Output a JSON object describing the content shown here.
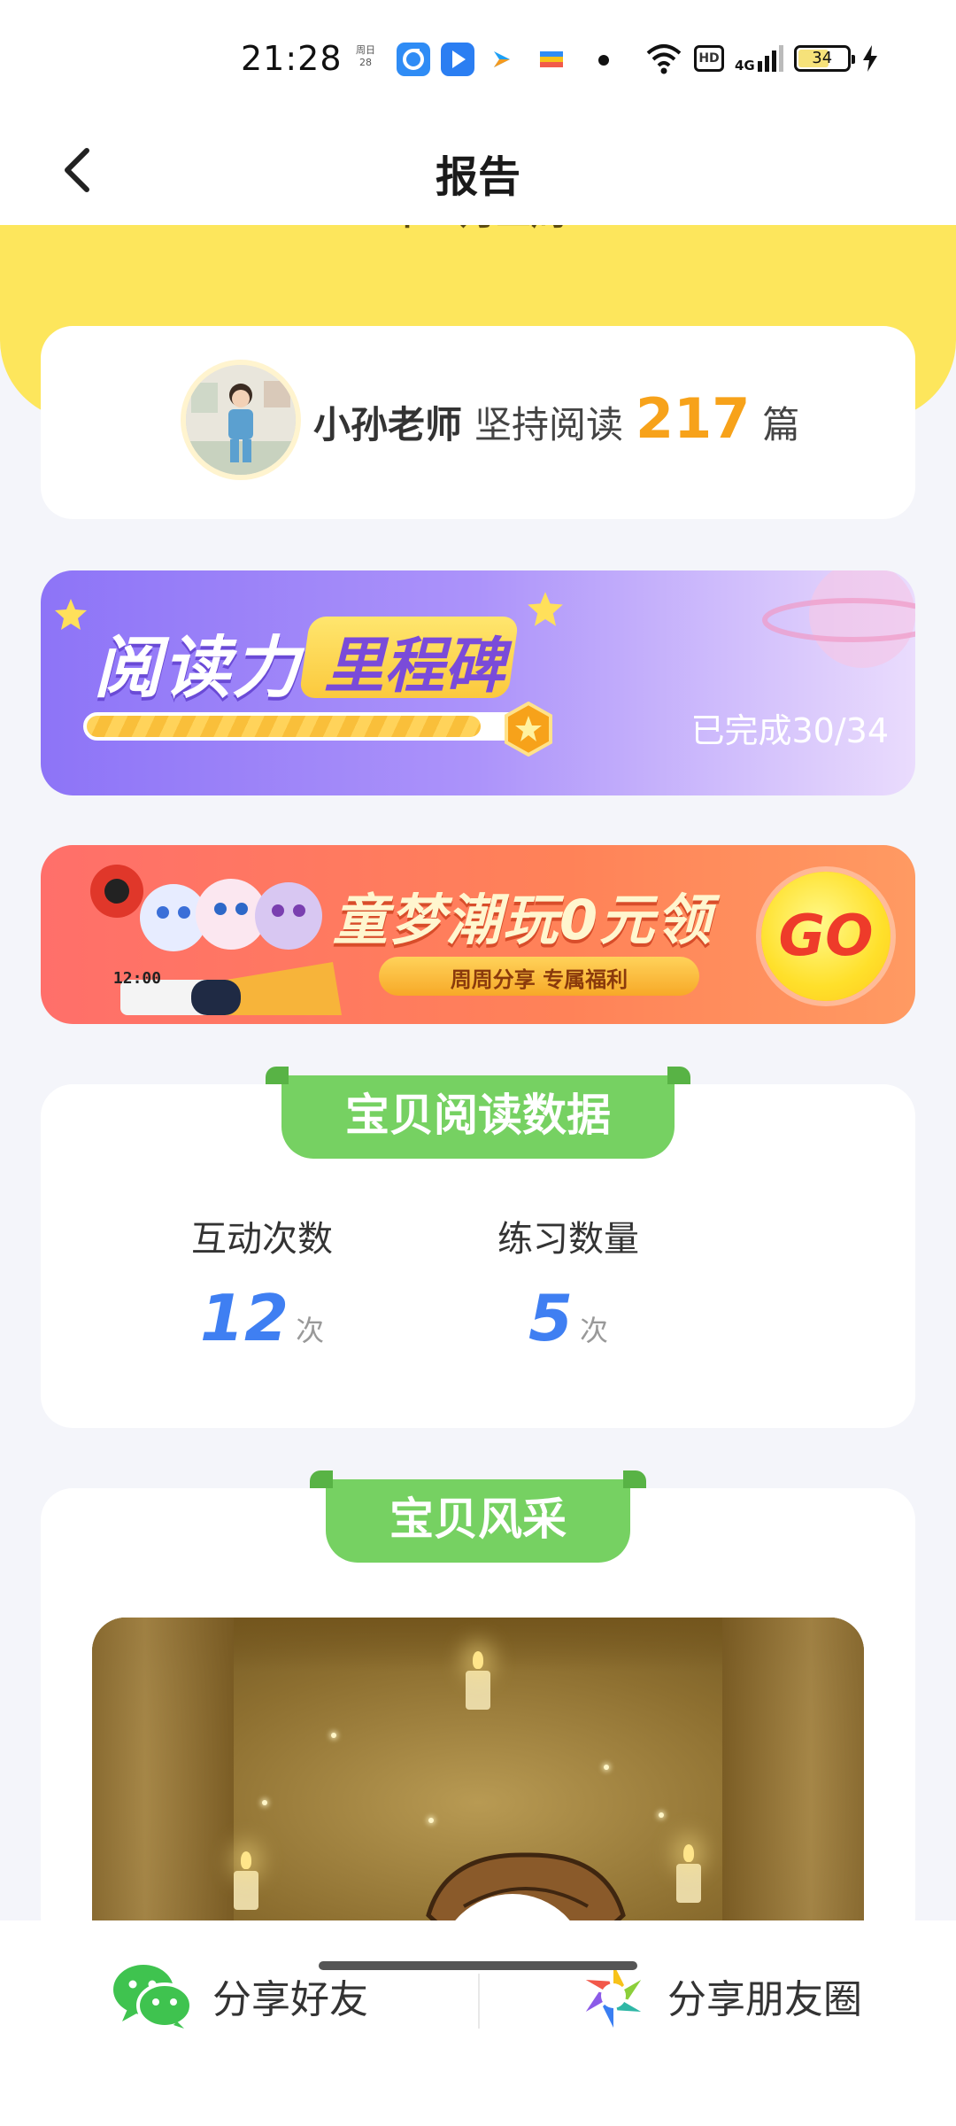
{
  "status_bar": {
    "time": "21:28",
    "calendar_label": "周日",
    "calendar_day": "28",
    "battery": "34",
    "network": "4G",
    "hd_label": "HD"
  },
  "nav": {
    "title": "报告",
    "back_icon": "chevron-left-icon"
  },
  "header_peek": "十二月三周",
  "profile": {
    "name": "小孙老师",
    "text": "坚持阅读",
    "count": "217",
    "unit": "篇"
  },
  "milestone": {
    "title": "阅读力",
    "tag": "里程碑",
    "progress_text": "已完成30/34",
    "completed": 30,
    "total": 34
  },
  "promo": {
    "title": "童梦潮玩0元领",
    "subtitle": "周周分享 专属福利",
    "go_label": "GO",
    "clock_text": "12:00"
  },
  "reading_data": {
    "title": "宝贝阅读数据",
    "stats": [
      {
        "label": "互动次数",
        "value": "12",
        "unit": "次"
      },
      {
        "label": "练习数量",
        "value": "5",
        "unit": "次"
      }
    ]
  },
  "baby_style": {
    "title": "宝贝风采"
  },
  "share": {
    "friends_label": "分享好友",
    "moments_label": "分享朋友圈"
  },
  "colors": {
    "accent_orange": "#f7a21a",
    "stat_blue": "#3f7ff2",
    "ribbon_green": "#76d162",
    "header_yellow": "#fde65c"
  }
}
